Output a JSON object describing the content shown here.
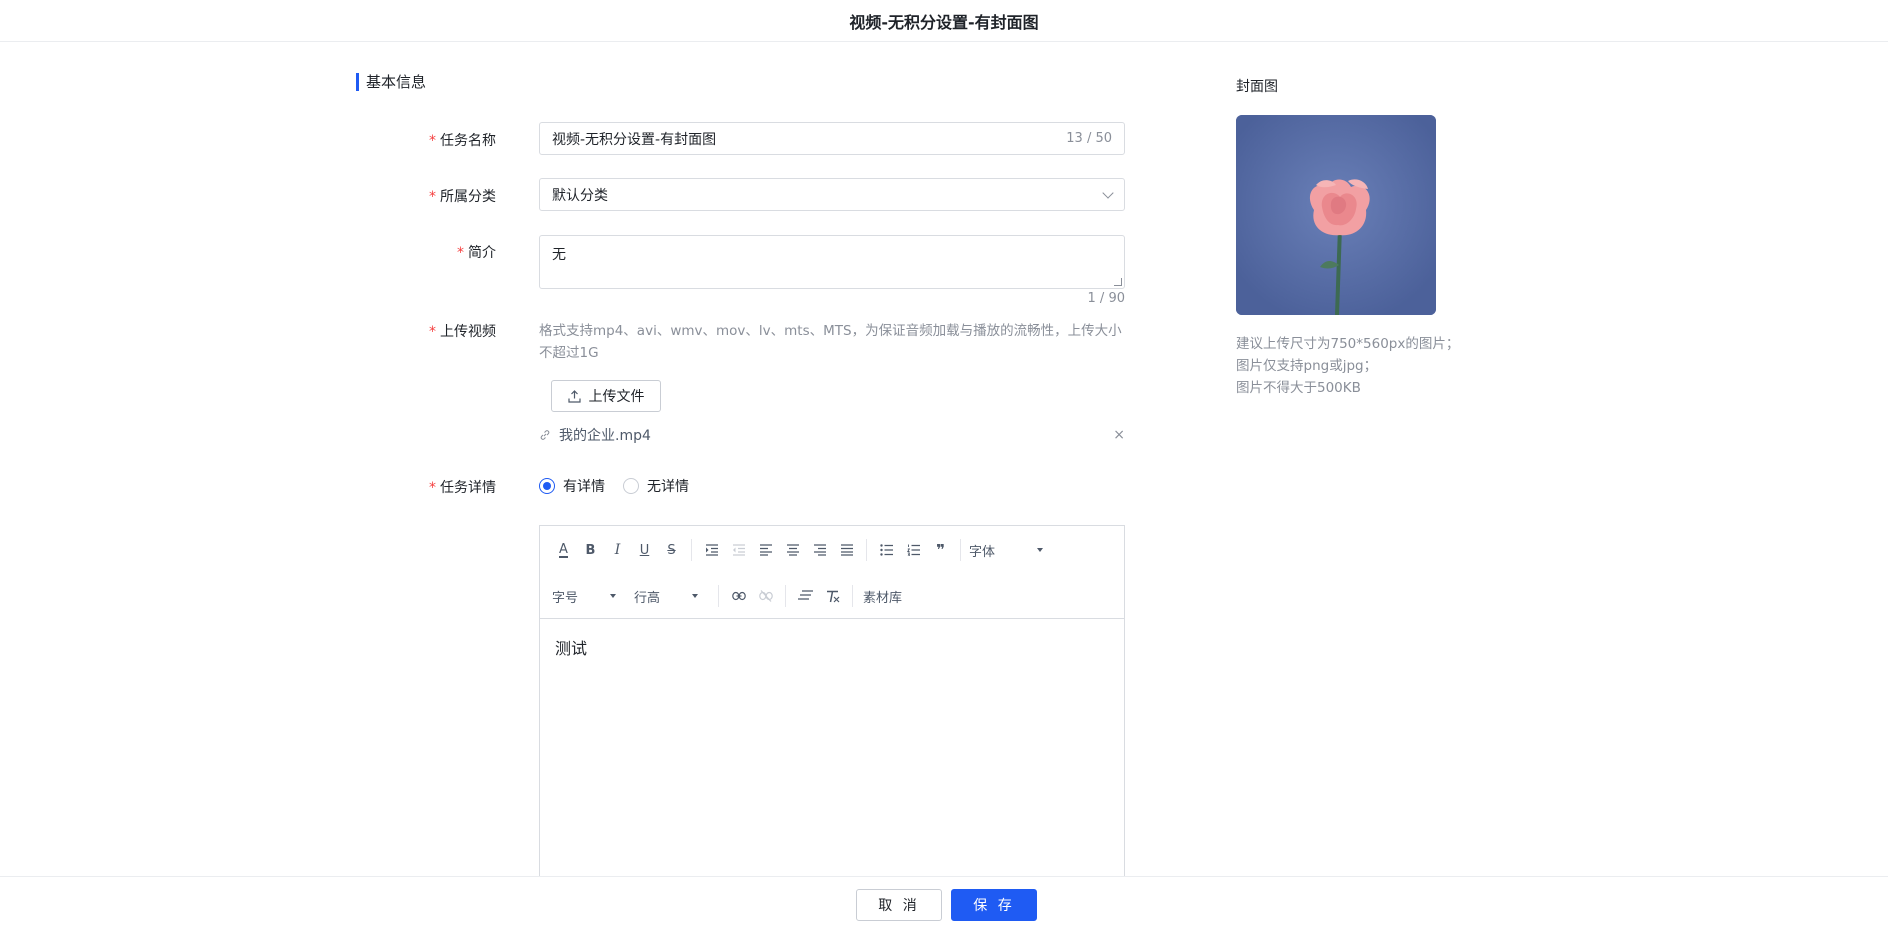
{
  "header": {
    "title": "视频-无积分设置-有封面图"
  },
  "section": {
    "title": "基本信息"
  },
  "form": {
    "required_mark": "*",
    "task_name": {
      "label": "任务名称",
      "value": "视频-无积分设置-有封面图",
      "count": "13 / 50"
    },
    "category": {
      "label": "所属分类",
      "value": "默认分类"
    },
    "intro": {
      "label": "简介",
      "value": "无",
      "count": "1 / 90"
    },
    "upload": {
      "label": "上传视频",
      "hint": "格式支持mp4、avi、wmv、mov、lv、mts、MTS，为保证音频加载与播放的流畅性，上传大小不超过1G",
      "button_label": "上传文件",
      "file_name": "我的企业.mp4",
      "remove_glyph": "×"
    },
    "detail": {
      "label": "任务详情",
      "options": [
        {
          "label": "有详情",
          "selected": true
        },
        {
          "label": "无详情",
          "selected": false
        }
      ]
    }
  },
  "editor": {
    "font_label": "字体",
    "size_label": "字号",
    "line_height_label": "行高",
    "library_label": "素材库",
    "bold": "B",
    "italic": "I",
    "underline": "U",
    "strike": "S",
    "text_color": "A",
    "quote": "❞",
    "content": "测试"
  },
  "footer": {
    "cancel_label": "取 消",
    "save_label": "保 存"
  },
  "cover": {
    "label": "封面图",
    "tips": [
      "建议上传尺寸为750*560px的图片；",
      "图片仅支持png或jpg；",
      "图片不得大于500KB"
    ]
  },
  "colors": {
    "primary": "#1f5bf3",
    "required": "#f53f3f",
    "cover_bg": "#5169a3",
    "rose": "#ee8f8f"
  }
}
